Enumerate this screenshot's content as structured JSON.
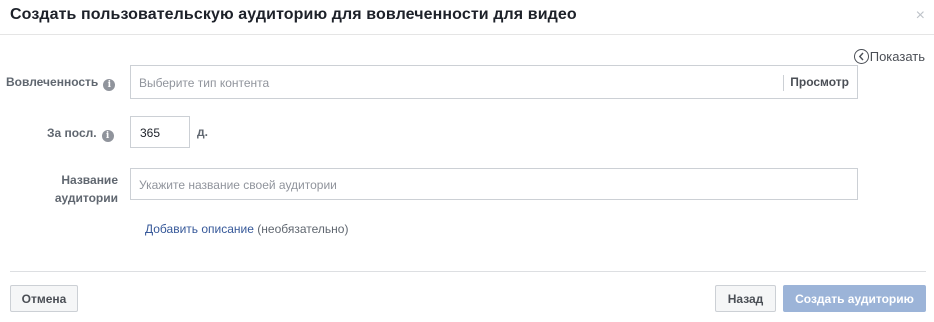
{
  "dialog": {
    "title": "Создать пользовательскую аудиторию для вовлеченности для видео",
    "close_symbol": "×"
  },
  "show_toggle": {
    "label": "Показать",
    "icon": "chevron-left-circle-icon"
  },
  "engagement": {
    "label": "Вовлеченность",
    "placeholder": "Выберите тип контента",
    "preview_label": "Просмотр"
  },
  "retention": {
    "label": "За посл.",
    "value": "365",
    "unit": "д."
  },
  "audience_name": {
    "label_line1": "Название",
    "label_line2": "аудитории",
    "placeholder": "Укажите название своей аудитории"
  },
  "description": {
    "link_label": "Добавить описание",
    "optional_label": "(необязательно)"
  },
  "footer": {
    "cancel_label": "Отмена",
    "back_label": "Назад",
    "create_label": "Создать аудиторию"
  },
  "colors": {
    "link": "#365899",
    "primary_disabled": "#9cb4d8",
    "border": "#ccd0d5"
  }
}
